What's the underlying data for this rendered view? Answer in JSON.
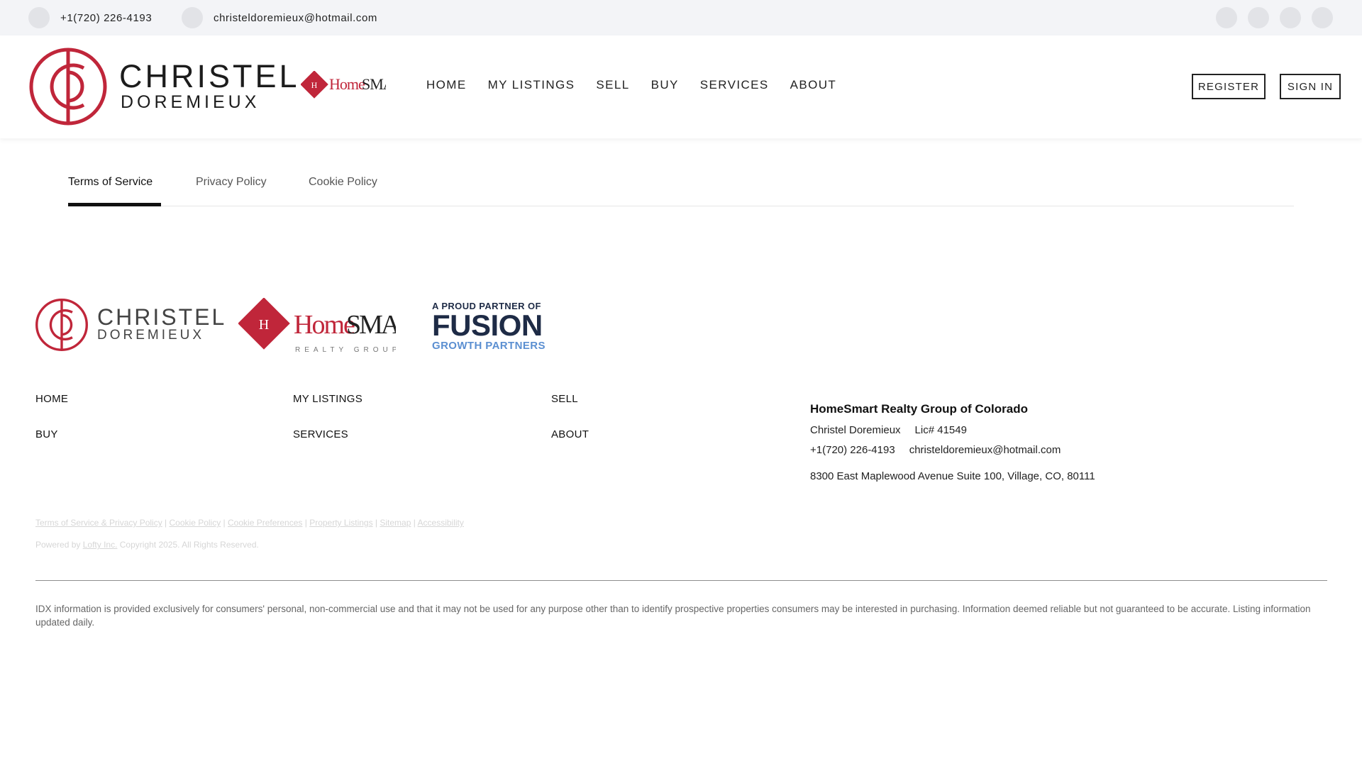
{
  "topbar": {
    "phone": "+1(720) 226-4193",
    "email": "christeldoremieux@hotmail.com",
    "social_icons": [
      "facebook-icon",
      "instagram-icon",
      "linkedin-icon",
      "youtube-icon"
    ]
  },
  "header": {
    "logo_line1": "CHRISTEL",
    "logo_line2": "DOREMIEUX",
    "brokerage_logo": "HomeSmart Realty Group",
    "nav": [
      "HOME",
      "MY LISTINGS",
      "SELL",
      "BUY",
      "SERVICES",
      "ABOUT"
    ],
    "register_label": "REGISTER",
    "signin_label": "SIGN IN"
  },
  "tabs": {
    "items": [
      "Terms of Service",
      "Privacy Policy",
      "Cookie Policy"
    ],
    "active": "Terms of Service"
  },
  "footer": {
    "logo_line1": "CHRISTEL",
    "logo_line2": "DOREMIEUX",
    "partner_line1": "A PROUD PARTNER OF",
    "partner_line2": "FUSION",
    "partner_line3": "GROWTH PARTNERS",
    "nav": [
      "HOME",
      "MY LISTINGS",
      "SELL",
      "BUY",
      "SERVICES",
      "ABOUT"
    ],
    "office": {
      "name": "HomeSmart Realty Group of Colorado",
      "agent": "Christel Doremieux",
      "license": "Lic# 41549",
      "phone": "+1(720) 226-4193",
      "email": "christeldoremieux@hotmail.com",
      "address": "8300 East Maplewood Avenue Suite 100, Village, CO, 80111"
    },
    "legal_links": [
      "Terms of Service & Privacy Policy",
      "Cookie Policy",
      "Cookie Preferences",
      "Property Listings",
      "Sitemap",
      "Accessibility"
    ],
    "powered_prefix": "Powered by",
    "powered_link": "Lofty Inc.",
    "copyright": "Copyright 2025. All Rights Reserved.",
    "idx_disclaimer": "IDX information is provided exclusively for consumers' personal, non-commercial use and that it may not be used for any purpose other than to identify prospective properties consumers may be interested in purchasing. Information deemed reliable but not guaranteed to be accurate. Listing information updated daily."
  },
  "colors": {
    "brand_red": "#c0263a",
    "topbar_bg": "#f3f4f7",
    "fusion_navy": "#1e2b46",
    "fusion_blue": "#5b8fd1"
  }
}
